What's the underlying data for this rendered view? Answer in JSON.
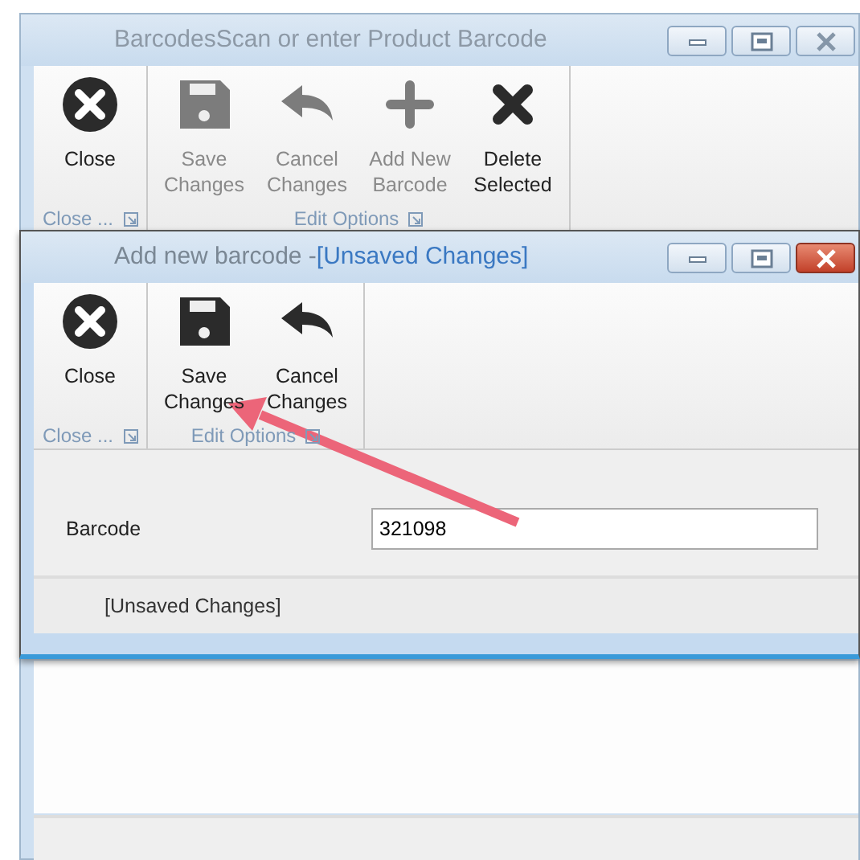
{
  "back_window": {
    "title": "BarcodesScan or enter Product Barcode",
    "active": false,
    "groups": [
      {
        "label": "Close ...",
        "buttons": [
          {
            "label": "Close",
            "kind": "close",
            "disabled": false
          }
        ]
      },
      {
        "label": "Edit Options",
        "buttons": [
          {
            "label": "Save Changes",
            "kind": "save",
            "disabled": true
          },
          {
            "label": "Cancel Changes",
            "kind": "undo",
            "disabled": true
          },
          {
            "label": "Add New Barcode",
            "kind": "plus",
            "disabled": true
          },
          {
            "label": "Delete Selected",
            "kind": "delete",
            "disabled": false
          }
        ]
      }
    ]
  },
  "front_window": {
    "title": "Add new barcode - ",
    "title_suffix": "[Unsaved Changes]",
    "active": true,
    "groups": [
      {
        "label": "Close ...",
        "buttons": [
          {
            "label": "Close",
            "kind": "close",
            "disabled": false
          }
        ]
      },
      {
        "label": "Edit Options",
        "buttons": [
          {
            "label": "Save Changes",
            "kind": "save",
            "disabled": false
          },
          {
            "label": "Cancel Changes",
            "kind": "undo",
            "disabled": false
          }
        ]
      }
    ]
  },
  "form": {
    "fields": [
      {
        "label": "Barcode",
        "value": "321098"
      }
    ]
  },
  "status_bar": {
    "text": "[Unsaved Changes]"
  }
}
